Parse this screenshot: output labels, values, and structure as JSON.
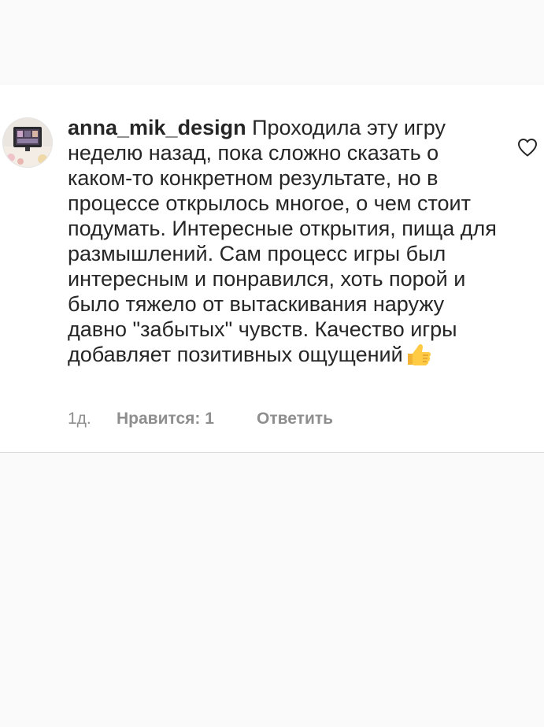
{
  "comment": {
    "username": "anna_mik_design",
    "text": "Проходила эту игру неделю назад, пока сложно сказать о каком-то конкретном результате, но в процессе открылось многое, о чем стоит подумать. Интересные открытия, пища для размышлений. Сам процесс игры был интересным и понравился, хоть порой и было тяжело от вытаскивания наружу давно \"забытых\" чувств. Качество игры добавляет позитивных ощущений",
    "emoji": "thumbs-up",
    "time": "1д.",
    "likes_label": "Нравится: 1",
    "reply_label": "Ответить"
  },
  "icons": {
    "like": "heart-outline-icon",
    "emoji": "thumbs-up-icon"
  },
  "colors": {
    "text": "#262626",
    "secondary": "#8e8e8e",
    "background": "#fafafa",
    "card": "#ffffff",
    "divider": "#dbdbdb"
  }
}
